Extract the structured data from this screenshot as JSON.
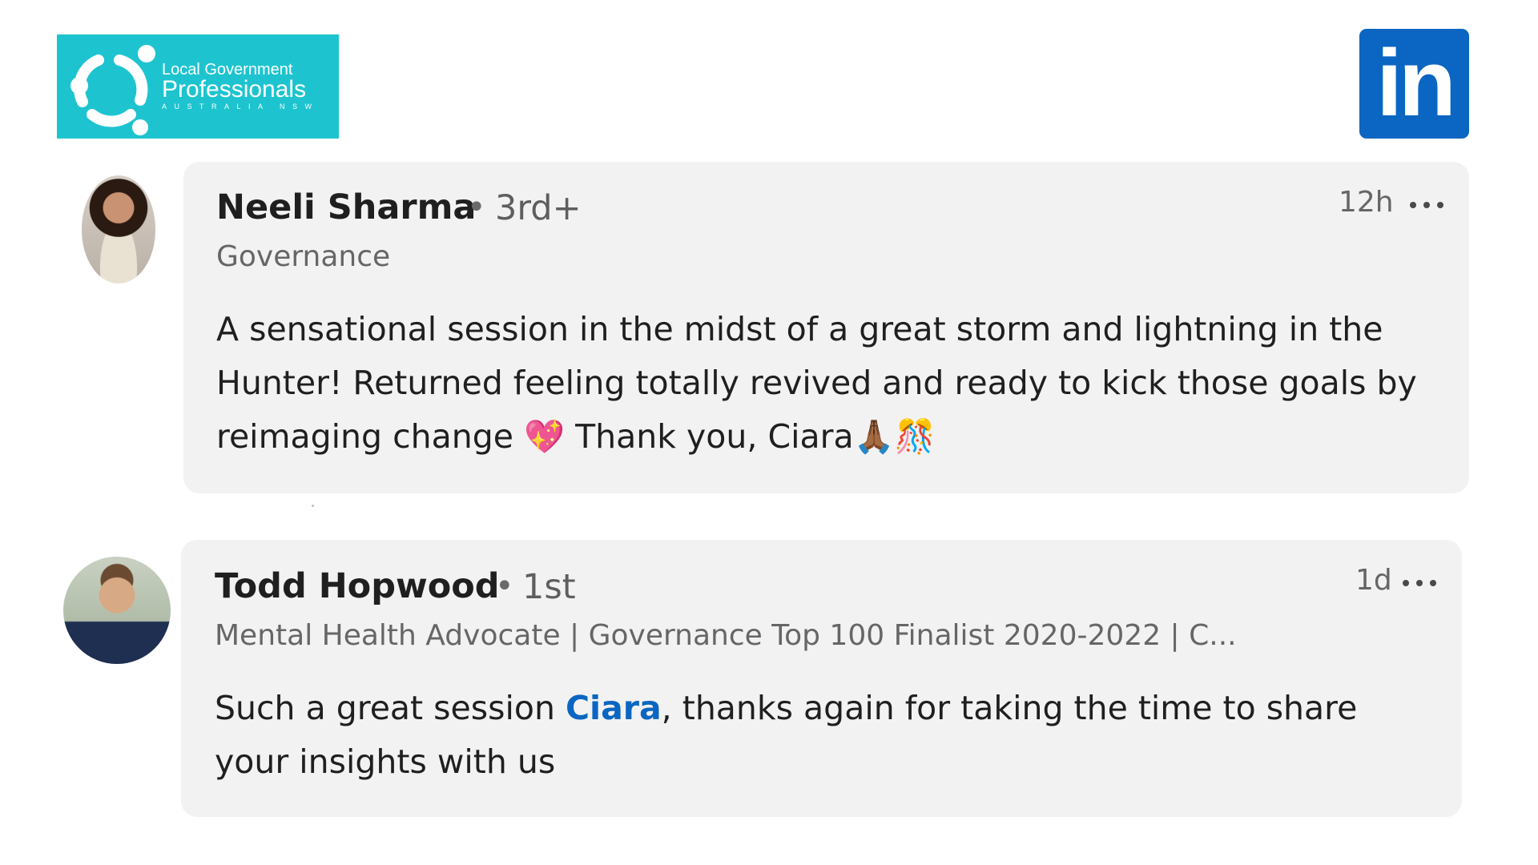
{
  "brand": {
    "org_line1": "Local Government",
    "org_line2": "Professionals",
    "org_line3": "AUSTRALIA NSW",
    "org_color": "#1dc4cf",
    "linkedin_text": "in",
    "linkedin_color": "#0a66c2"
  },
  "comments": [
    {
      "name": "Neeli Sharma",
      "separator": "•",
      "degree": "3rd+",
      "headline": "Governance",
      "time": "12h",
      "text": "A sensational session in the midst of a great storm and lightning in the Hunter! Returned feeling totally revived and ready to kick those goals by reimaging change",
      "text_after_emoji": " Thank you, Ciara",
      "emoji_1": "💖",
      "emoji_2": "🙏🏾",
      "emoji_3": "🎊"
    },
    {
      "name": "Todd Hopwood",
      "separator": "•",
      "degree": "1st",
      "headline": "Mental Health Advocate | Governance Top 100 Finalist 2020-2022 | C...",
      "time": "1d",
      "text_before": "Such a great session ",
      "mention": "Ciara",
      "text_after": ", thanks again for taking the time to share your insights with us"
    }
  ]
}
